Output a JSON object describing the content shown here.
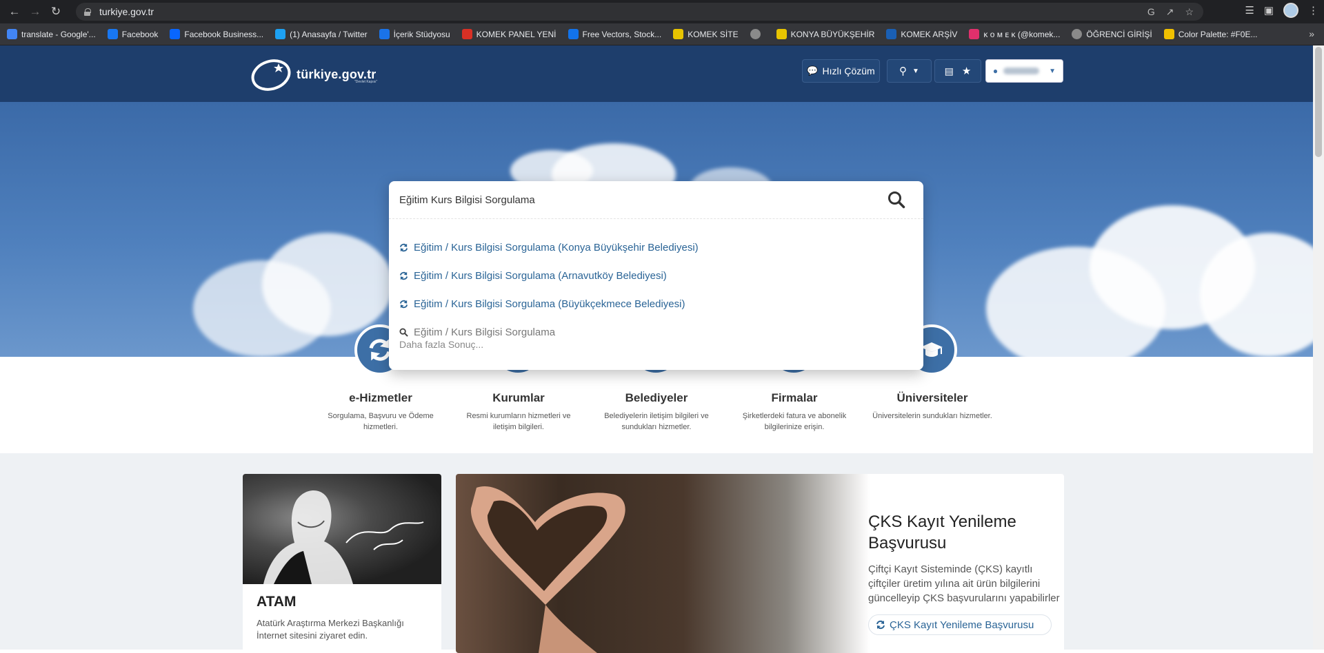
{
  "browser": {
    "url": "turkiye.gov.tr",
    "bookmarks": [
      {
        "label": "translate - Google'...",
        "icon": "google-icon",
        "color": "#4285f4"
      },
      {
        "label": "Facebook",
        "icon": "facebook-icon",
        "color": "#1877f2"
      },
      {
        "label": "Facebook Business...",
        "icon": "meta-icon",
        "color": "#0866ff"
      },
      {
        "label": "(1) Anasayfa / Twitter",
        "icon": "twitter-icon",
        "color": "#1da1f2"
      },
      {
        "label": "İçerik Stüdyosu",
        "icon": "calendar-icon",
        "color": "#1a73e8"
      },
      {
        "label": "KOMEK PANEL YENİ",
        "icon": "star-icon",
        "color": "#d93025"
      },
      {
        "label": "Free Vectors, Stock...",
        "icon": "freepik-icon",
        "color": "#1273eb"
      },
      {
        "label": "KOMEK SİTE",
        "icon": "komek-icon",
        "color": "#e8c400"
      },
      {
        "label": "",
        "icon": "globe-icon",
        "color": "#8a8a8a"
      },
      {
        "label": "KONYA BÜYÜKŞEHİR",
        "icon": "konya-icon",
        "color": "#e8c400"
      },
      {
        "label": "KOMEK ARŞİV",
        "icon": "dsh-icon",
        "color": "#1a5fb4"
      },
      {
        "label": "ᴋ ᴏ ᴍ ᴇ ᴋ (@komek...",
        "icon": "instagram-icon",
        "color": "#e1306c"
      },
      {
        "label": "ÖĞRENCİ GİRİŞİ",
        "icon": "globe-icon",
        "color": "#8a8a8a"
      },
      {
        "label": "Color Palette: #F0E...",
        "icon": "palette-icon",
        "color": "#f0c000"
      }
    ]
  },
  "header": {
    "logo_text": "türkiye.gov.tr",
    "logo_sub": "\"Devlet Kapısı\"",
    "quick_solution_label": "Hızlı Çözüm",
    "brand_color": "#1e3e6c"
  },
  "search": {
    "query": "Eğitim Kurs Bilgisi Sorgulama",
    "suggestions": [
      {
        "label": "Eğitim / Kurs Bilgisi Sorgulama (Konya Büyükşehir Belediyesi)",
        "icon": "refresh-icon"
      },
      {
        "label": "Eğitim / Kurs Bilgisi Sorgulama (Arnavutköy Belediyesi)",
        "icon": "refresh-icon"
      },
      {
        "label": "Eğitim / Kurs Bilgisi Sorgulama (Büyükçekmece Belediyesi)",
        "icon": "refresh-icon"
      },
      {
        "label": "Eğitim / Kurs Bilgisi Sorgulama",
        "icon": "search-icon"
      }
    ],
    "more_results": "Daha fazla Sonuç..."
  },
  "categories": [
    {
      "title": "e-Hizmetler",
      "desc": "Sorgulama, Başvuru ve Ödeme hizmetleri.",
      "icon": "refresh-icon"
    },
    {
      "title": "Kurumlar",
      "desc": "Resmi kurumların hizmetleri ve iletişim bilgileri.",
      "icon": "building-icon"
    },
    {
      "title": "Belediyeler",
      "desc": "Belediyelerin iletişim bilgileri ve sundukları hizmetler.",
      "icon": "city-icon"
    },
    {
      "title": "Firmalar",
      "desc": "Şirketlerdeki fatura ve abonelik bilgilerinize erişin.",
      "icon": "briefcase-icon"
    },
    {
      "title": "Üniversiteler",
      "desc": "Üniversitelerin sundukları hizmetler.",
      "icon": "graduation-cap-icon"
    }
  ],
  "atam": {
    "title": "ATAM",
    "desc": "Atatürk Araştırma Merkezi Başkanlığı İnternet sitesini ziyaret edin.",
    "signature": "K. Atatürk"
  },
  "cks": {
    "title": "ÇKS Kayıt Yenileme Başvurusu",
    "desc": "Çiftçi Kayıt Sisteminde (ÇKS) kayıtlı çiftçiler üretim yılına ait ürün bilgilerini güncelleyip ÇKS başvurularını yapabilirler",
    "link_label": "ÇKS Kayıt Yenileme Başvurusu"
  }
}
